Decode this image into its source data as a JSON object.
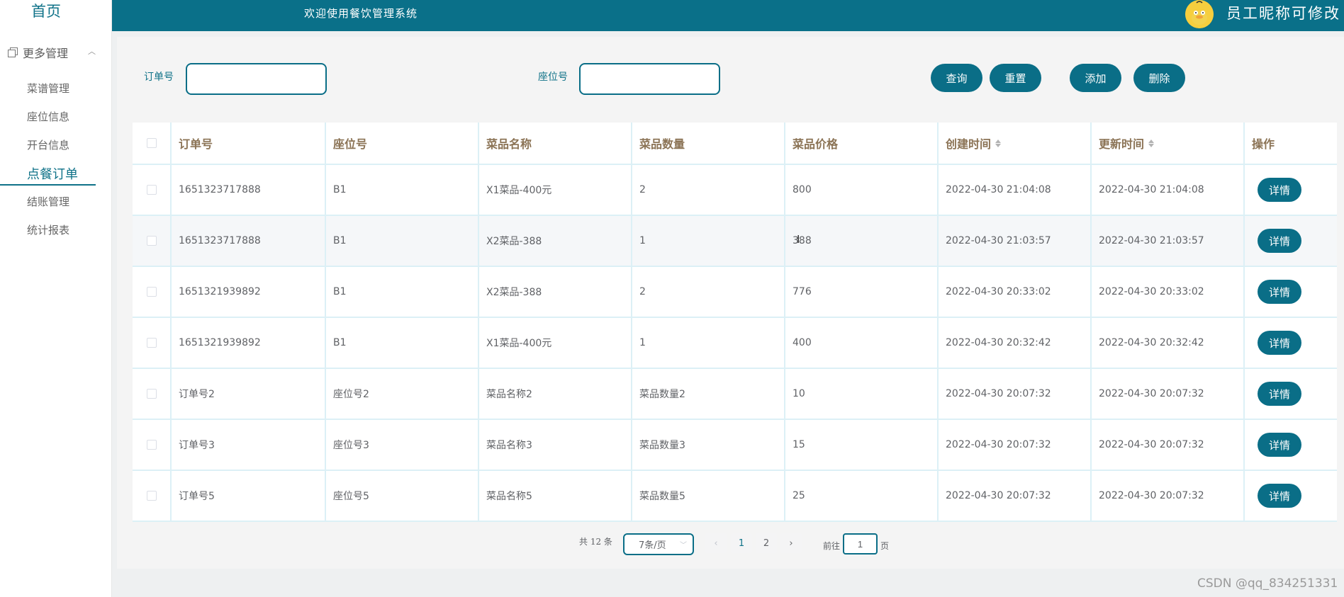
{
  "sidebar": {
    "home": "首页",
    "group_label": "更多管理",
    "items": [
      "菜谱管理",
      "座位信息",
      "开台信息",
      "点餐订单",
      "结账管理",
      "统计报表"
    ],
    "active_item": "点餐订单"
  },
  "header": {
    "welcome": "欢迎使用餐饮管理系统",
    "username": "员工昵称可修改"
  },
  "search": {
    "order_label": "订单号",
    "order_value": "",
    "seat_label": "座位号",
    "seat_value": ""
  },
  "buttons": {
    "query": "查询",
    "reset": "重置",
    "add": "添加",
    "delete": "删除"
  },
  "table": {
    "columns": [
      "订单号",
      "座位号",
      "菜品名称",
      "菜品数量",
      "菜品价格",
      "创建时间",
      "更新时间",
      "操作"
    ],
    "rows": [
      [
        "1651323717888",
        "B1",
        "X1菜品-400元",
        "2",
        "800",
        "2022-04-30 21:04:08",
        "2022-04-30 21:04:08"
      ],
      [
        "1651323717888",
        "B1",
        "X2菜品-388",
        "1",
        "388",
        "2022-04-30 21:03:57",
        "2022-04-30 21:03:57"
      ],
      [
        "1651321939892",
        "B1",
        "X2菜品-388",
        "2",
        "776",
        "2022-04-30 20:33:02",
        "2022-04-30 20:33:02"
      ],
      [
        "1651321939892",
        "B1",
        "X1菜品-400元",
        "1",
        "400",
        "2022-04-30 20:32:42",
        "2022-04-30 20:32:42"
      ],
      [
        "订单号2",
        "座位号2",
        "菜品名称2",
        "菜品数量2",
        "10",
        "2022-04-30 20:07:32",
        "2022-04-30 20:07:32"
      ],
      [
        "订单号3",
        "座位号3",
        "菜品名称3",
        "菜品数量3",
        "15",
        "2022-04-30 20:07:32",
        "2022-04-30 20:07:32"
      ],
      [
        "订单号5",
        "座位号5",
        "菜品名称5",
        "菜品数量5",
        "25",
        "2022-04-30 20:07:32",
        "2022-04-30 20:07:32"
      ]
    ],
    "detail_label": "详情"
  },
  "pagination": {
    "total": "共 12 条",
    "page_size": "7条/页",
    "prev": "‹",
    "pages": [
      "1",
      "2"
    ],
    "current_page": "1",
    "next": "›",
    "goto_prefix": "前往",
    "goto_value": "1",
    "goto_suffix": "页"
  },
  "watermark": "CSDN @qq_834251331",
  "colors": {
    "primary": "#0a7089",
    "header_text": "#8b7355"
  }
}
